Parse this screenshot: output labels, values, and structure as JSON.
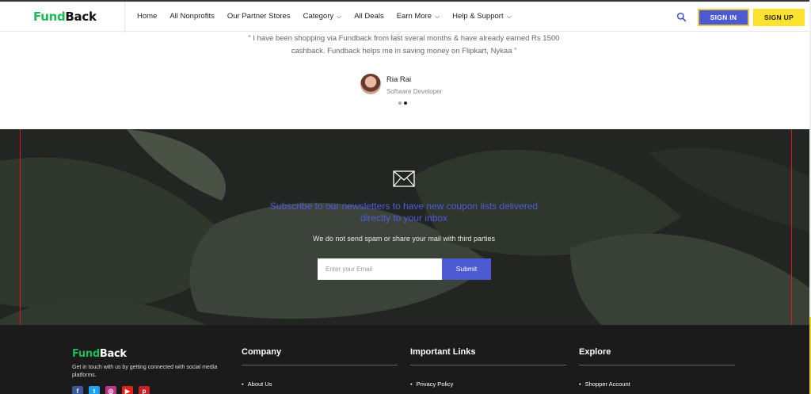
{
  "header": {
    "logo_part1": "Fund",
    "logo_part2": "Back",
    "nav": [
      {
        "label": "Home",
        "has_dropdown": false
      },
      {
        "label": "All Nonprofits",
        "has_dropdown": false
      },
      {
        "label": "Our Partner Stores",
        "has_dropdown": false
      },
      {
        "label": "Category",
        "has_dropdown": true
      },
      {
        "label": "All Deals",
        "has_dropdown": false
      },
      {
        "label": "Earn More",
        "has_dropdown": true
      },
      {
        "label": "Help & Support",
        "has_dropdown": true
      }
    ],
    "signin_label": "SIGN IN",
    "signup_label": "SIGN UP",
    "search_icon": "search-icon"
  },
  "testimonial": {
    "quote": "“ I have been shopping via Fundback from last sveral months & have already earned Rs 1500 cashback. Fundback helps me in saving money on Flipkart, Nykaa ”",
    "author_name": "Ria Rai",
    "author_role": "Software Developer",
    "slide_count": 2,
    "active_slide": 2
  },
  "newsletter": {
    "icon": "envelope-icon",
    "title": "Subscribe to our newsletters to have new coupon lists delivered directly to your inbox",
    "subtitle": "We do not send spam or share your mail with third parties",
    "email_placeholder": "Enter your Email",
    "submit_label": "Submit"
  },
  "footer": {
    "logo_part1": "Fund",
    "logo_part2": "Back",
    "description": "Get in touch with us by getting connected with social media platforms.",
    "socials": [
      "facebook-icon",
      "twitter-icon",
      "instagram-icon",
      "youtube-icon",
      "pinterest-icon"
    ],
    "columns": [
      {
        "title": "Company",
        "first_link": "About Us"
      },
      {
        "title": "Important Links",
        "first_link": "Privacy Policy"
      },
      {
        "title": "Explore",
        "first_link": "Shopper Account"
      }
    ]
  },
  "colors": {
    "brand_green": "#1db954",
    "accent_blue": "#4c5ad1",
    "accent_yellow": "#fde22f",
    "highlight_red": "#e01818"
  }
}
